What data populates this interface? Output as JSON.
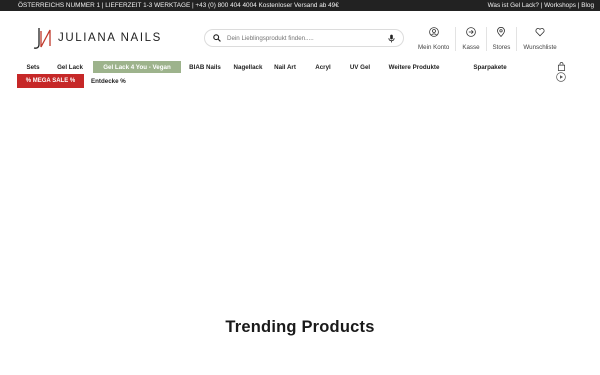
{
  "topbar": {
    "left": "ÖSTERREICHS NUMMER 1 | LIEFERZEIT 1-3 WERKTAGE | +43 (0) 800 404 4004    Kostenloser Versand ab 49€",
    "right_links": [
      "Was ist Gel Lack?",
      "Workshops",
      "Blog"
    ]
  },
  "header": {
    "brand": "JULIANA NAILS",
    "search_placeholder": "Dein Lieblingsprodukt finden.....",
    "icons": [
      {
        "label": "Mein Konto",
        "icon": "user-icon"
      },
      {
        "label": "Kasse",
        "icon": "arrow-right-circle-icon"
      },
      {
        "label": "Stores",
        "icon": "map-pin-icon"
      },
      {
        "label": "Wunschliste",
        "icon": "heart-icon"
      }
    ]
  },
  "nav": {
    "items": [
      "Sets",
      "Gel Lack",
      "Gel Lack 4 You - Vegan",
      "BIAB Nails",
      "Nagellack",
      "Nail Art",
      "Acryl",
      "UV Gel",
      "Weitere Produkte",
      "Sparpakete"
    ],
    "highlight_color": "#9db38c"
  },
  "row2": {
    "sale": "% MEGA SALE %",
    "discover": "Entdecke %",
    "sale_color": "#c62828"
  },
  "main": {
    "heading": "Trending Products"
  }
}
